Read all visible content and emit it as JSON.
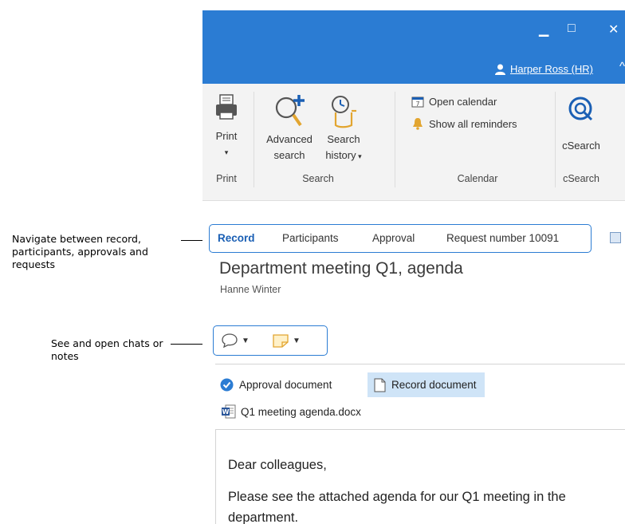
{
  "callouts": {
    "navigate": "Navigate between record, participants, approvals and requests",
    "chats": "See and open chats or notes"
  },
  "titlebar": {
    "minimize_glyph": "▁",
    "maximize_glyph": "□",
    "close_glyph": "✕",
    "user_name": "Harper Ross (HR)",
    "collapse_glyph": "^"
  },
  "ribbon": {
    "print_label": "Print",
    "advanced_search_label": "Advanced search",
    "search_history_label": "Search history",
    "open_calendar_label": "Open calendar",
    "show_reminders_label": "Show all reminders",
    "csearch_label": "cSearch",
    "groups": [
      "Print",
      "Search",
      "Calendar",
      "cSearch"
    ]
  },
  "tabs": [
    "Record",
    "Participants",
    "Approval",
    "Request number 10091"
  ],
  "record": {
    "title": "Department meeting Q1, agenda",
    "owner": "Hanne Winter"
  },
  "documents": {
    "approval_label": "Approval document",
    "record_label": "Record document",
    "file_name": "Q1 meeting agenda.docx"
  },
  "body": {
    "greeting": "Dear colleagues,",
    "paragraph": "Please see the attached agenda for our Q1 meeting in the department."
  },
  "colors": {
    "accent": "#2b7cd3",
    "selected_doc": "#cfe4f7"
  }
}
